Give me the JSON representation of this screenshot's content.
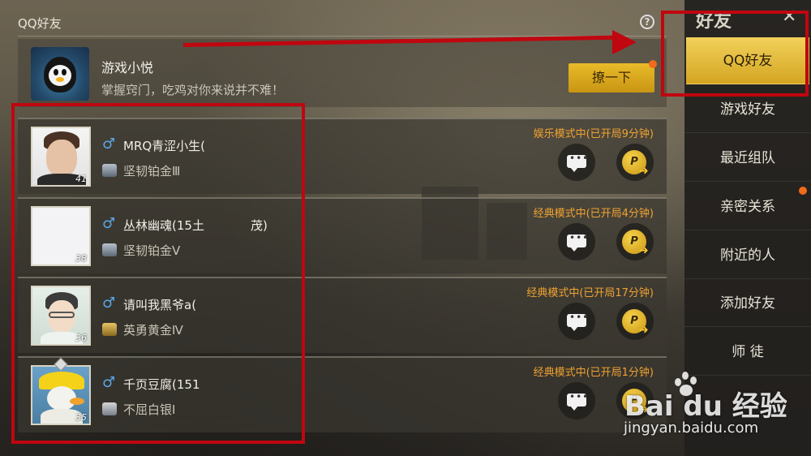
{
  "header": {
    "title": "QQ好友",
    "help_glyph": "?"
  },
  "assistant": {
    "name": "游戏小悦",
    "message": "掌握窍门，吃鸡对你来说并不难！",
    "poke_label": "撩一下"
  },
  "friends": [
    {
      "name": "MRQ青涩小生(",
      "rank": "坚韧铂金Ⅲ",
      "status": "娱乐模式中(已开局9分钟)",
      "level": "41",
      "gender": "♂",
      "rank_tier": "platinum"
    },
    {
      "name": "丛林幽魂(15土",
      "name_tail": "茂)",
      "rank": "坚韧铂金Ⅴ",
      "status": "经典模式中(已开局4分钟)",
      "level": "38",
      "gender": "♂",
      "rank_tier": "platinum"
    },
    {
      "name": "请叫我黑爷a(",
      "rank": "英勇黄金Ⅳ",
      "status": "经典模式中(已开局17分钟)",
      "level": "36",
      "gender": "♂",
      "rank_tier": "gold"
    },
    {
      "name": "千页豆腐(151",
      "rank": "不屈白银Ⅰ",
      "status": "经典模式中(已开局1分钟)",
      "level": "35",
      "gender": "♂",
      "rank_tier": "silver"
    }
  ],
  "actions": {
    "invite_glyph": "P",
    "invite_arrow": "➜"
  },
  "sidebar": {
    "title": "好友",
    "close_glyph": "✕",
    "items": [
      {
        "label": "QQ好友",
        "active": true
      },
      {
        "label": "游戏好友"
      },
      {
        "label": "最近组队"
      },
      {
        "label": "亲密关系"
      },
      {
        "label": "附近的人"
      },
      {
        "label": "添加好友"
      },
      {
        "label": "师 徒"
      }
    ]
  },
  "watermark": {
    "logo": "Bai  du 经验",
    "url": "jingyan.baidu.com"
  },
  "colors": {
    "accent": "#e9bb2a",
    "status": "#f0a230",
    "annotation": "#c0060f",
    "notify": "#f26a1b"
  }
}
